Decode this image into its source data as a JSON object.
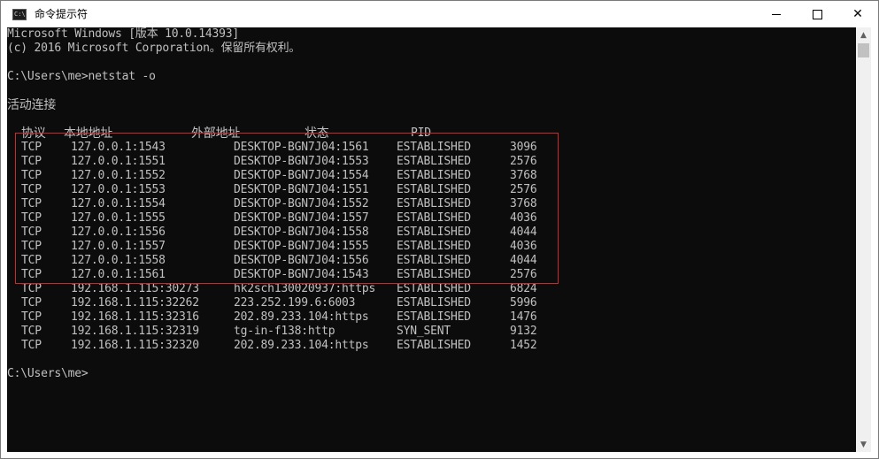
{
  "window": {
    "title": "命令提示符",
    "icon_text": "C:\\",
    "minimize_glyph": "—",
    "maximize_glyph": "☐",
    "close_glyph": "✕"
  },
  "console": {
    "banner_line1": "Microsoft Windows [版本 10.0.14393]",
    "banner_line2": "(c) 2016 Microsoft Corporation。保留所有权利。",
    "prompt_command": "C:\\Users\\me>netstat -o",
    "section_title": "活动连接",
    "headers": {
      "proto": "协议",
      "local": "本地地址",
      "foreign": "外部地址",
      "state": "状态",
      "pid": "PID"
    },
    "rows": [
      {
        "proto": "TCP",
        "local": "127.0.0.1:1543",
        "foreign": "DESKTOP-BGN7J04:1561",
        "state": "ESTABLISHED",
        "pid": "3096"
      },
      {
        "proto": "TCP",
        "local": "127.0.0.1:1551",
        "foreign": "DESKTOP-BGN7J04:1553",
        "state": "ESTABLISHED",
        "pid": "2576"
      },
      {
        "proto": "TCP",
        "local": "127.0.0.1:1552",
        "foreign": "DESKTOP-BGN7J04:1554",
        "state": "ESTABLISHED",
        "pid": "3768"
      },
      {
        "proto": "TCP",
        "local": "127.0.0.1:1553",
        "foreign": "DESKTOP-BGN7J04:1551",
        "state": "ESTABLISHED",
        "pid": "2576"
      },
      {
        "proto": "TCP",
        "local": "127.0.0.1:1554",
        "foreign": "DESKTOP-BGN7J04:1552",
        "state": "ESTABLISHED",
        "pid": "3768"
      },
      {
        "proto": "TCP",
        "local": "127.0.0.1:1555",
        "foreign": "DESKTOP-BGN7J04:1557",
        "state": "ESTABLISHED",
        "pid": "4036"
      },
      {
        "proto": "TCP",
        "local": "127.0.0.1:1556",
        "foreign": "DESKTOP-BGN7J04:1558",
        "state": "ESTABLISHED",
        "pid": "4044"
      },
      {
        "proto": "TCP",
        "local": "127.0.0.1:1557",
        "foreign": "DESKTOP-BGN7J04:1555",
        "state": "ESTABLISHED",
        "pid": "4036"
      },
      {
        "proto": "TCP",
        "local": "127.0.0.1:1558",
        "foreign": "DESKTOP-BGN7J04:1556",
        "state": "ESTABLISHED",
        "pid": "4044"
      },
      {
        "proto": "TCP",
        "local": "127.0.0.1:1561",
        "foreign": "DESKTOP-BGN7J04:1543",
        "state": "ESTABLISHED",
        "pid": "2576"
      },
      {
        "proto": "TCP",
        "local": "192.168.1.115:30273",
        "foreign": "hk2sch130020937:https",
        "state": "ESTABLISHED",
        "pid": "6824"
      },
      {
        "proto": "TCP",
        "local": "192.168.1.115:32262",
        "foreign": "223.252.199.6:6003",
        "state": "ESTABLISHED",
        "pid": "5996"
      },
      {
        "proto": "TCP",
        "local": "192.168.1.115:32316",
        "foreign": "202.89.233.104:https",
        "state": "ESTABLISHED",
        "pid": "1476"
      },
      {
        "proto": "TCP",
        "local": "192.168.1.115:32319",
        "foreign": "tg-in-f138:http",
        "state": "SYN_SENT",
        "pid": "9132"
      },
      {
        "proto": "TCP",
        "local": "192.168.1.115:32320",
        "foreign": "202.89.233.104:https",
        "state": "ESTABLISHED",
        "pid": "1452"
      }
    ],
    "final_prompt": "C:\\Users\\me>",
    "scroll_up_glyph": "▲",
    "scroll_down_glyph": "▼"
  },
  "colors": {
    "console_bg": "#0c0c0c",
    "console_text": "#c0c0c0",
    "highlight_border": "#cc2a2a"
  }
}
